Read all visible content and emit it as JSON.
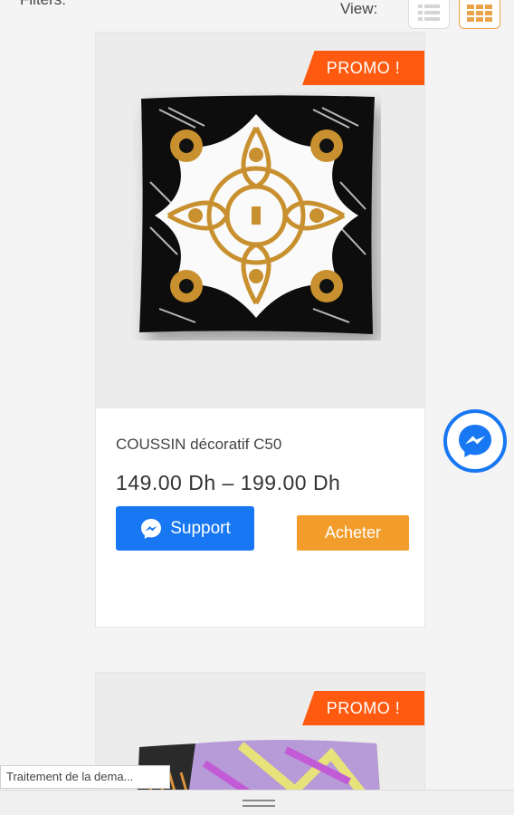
{
  "toolbar": {
    "filters_label": "Filters:",
    "view_label": "View:",
    "view_modes": [
      "list-view-icon",
      "grid-view-icon"
    ],
    "active_view": "grid"
  },
  "products": [
    {
      "badge": "PROMO !",
      "title": "COUSSIN décoratif C50",
      "price": "149.00 Dh – 199.00 Dh",
      "support_label": "Support",
      "buy_label": "Acheter"
    },
    {
      "badge": "PROMO !"
    }
  ],
  "messenger": {
    "icon": "messenger-icon"
  },
  "status": {
    "text": "Traitement de la dema..."
  },
  "colors": {
    "promo": "#ff5a10",
    "support": "#1877f2",
    "buy": "#f29d2b",
    "grid_active": "#e9a34b"
  }
}
